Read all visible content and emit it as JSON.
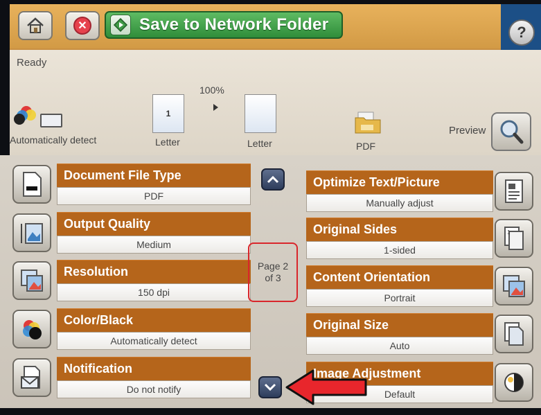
{
  "header": {
    "start_label": "Save to Network Folder",
    "help_label": "?"
  },
  "status": {
    "text": "Ready",
    "color_mode_label": "Automatically detect",
    "original_page_number": "1",
    "original_label": "Letter",
    "zoom": "100%",
    "output_label": "Letter",
    "file_type_label": "PDF",
    "preview_label": "Preview"
  },
  "settings": {
    "left": [
      {
        "title": "Document File Type",
        "value": "PDF",
        "icon": "document-file-type-icon"
      },
      {
        "title": "Output Quality",
        "value": "Medium",
        "icon": "output-quality-icon"
      },
      {
        "title": "Resolution",
        "value": "150 dpi",
        "icon": "resolution-icon"
      },
      {
        "title": "Color/Black",
        "value": "Automatically detect",
        "icon": "color-black-icon"
      },
      {
        "title": "Notification",
        "value": "Do not notify",
        "icon": "notification-icon"
      }
    ],
    "right": [
      {
        "title": "Optimize Text/Picture",
        "value": "Manually adjust",
        "icon": "optimize-text-picture-icon"
      },
      {
        "title": "Original Sides",
        "value": "1-sided",
        "icon": "original-sides-icon"
      },
      {
        "title": "Content Orientation",
        "value": "Portrait",
        "icon": "content-orientation-icon"
      },
      {
        "title": "Original Size",
        "value": "Auto",
        "icon": "original-size-icon"
      },
      {
        "title": "Image Adjustment",
        "value": "Default",
        "icon": "image-adjustment-icon"
      }
    ]
  },
  "pagination": {
    "line1": "Page 2",
    "line2": "of 3"
  },
  "colors": {
    "header_bar": "#d29a45",
    "start_button": "#2f8d3a",
    "setting_header": "#b5651b",
    "help_area": "#1c4f86",
    "annotation_red": "#e8262c"
  }
}
